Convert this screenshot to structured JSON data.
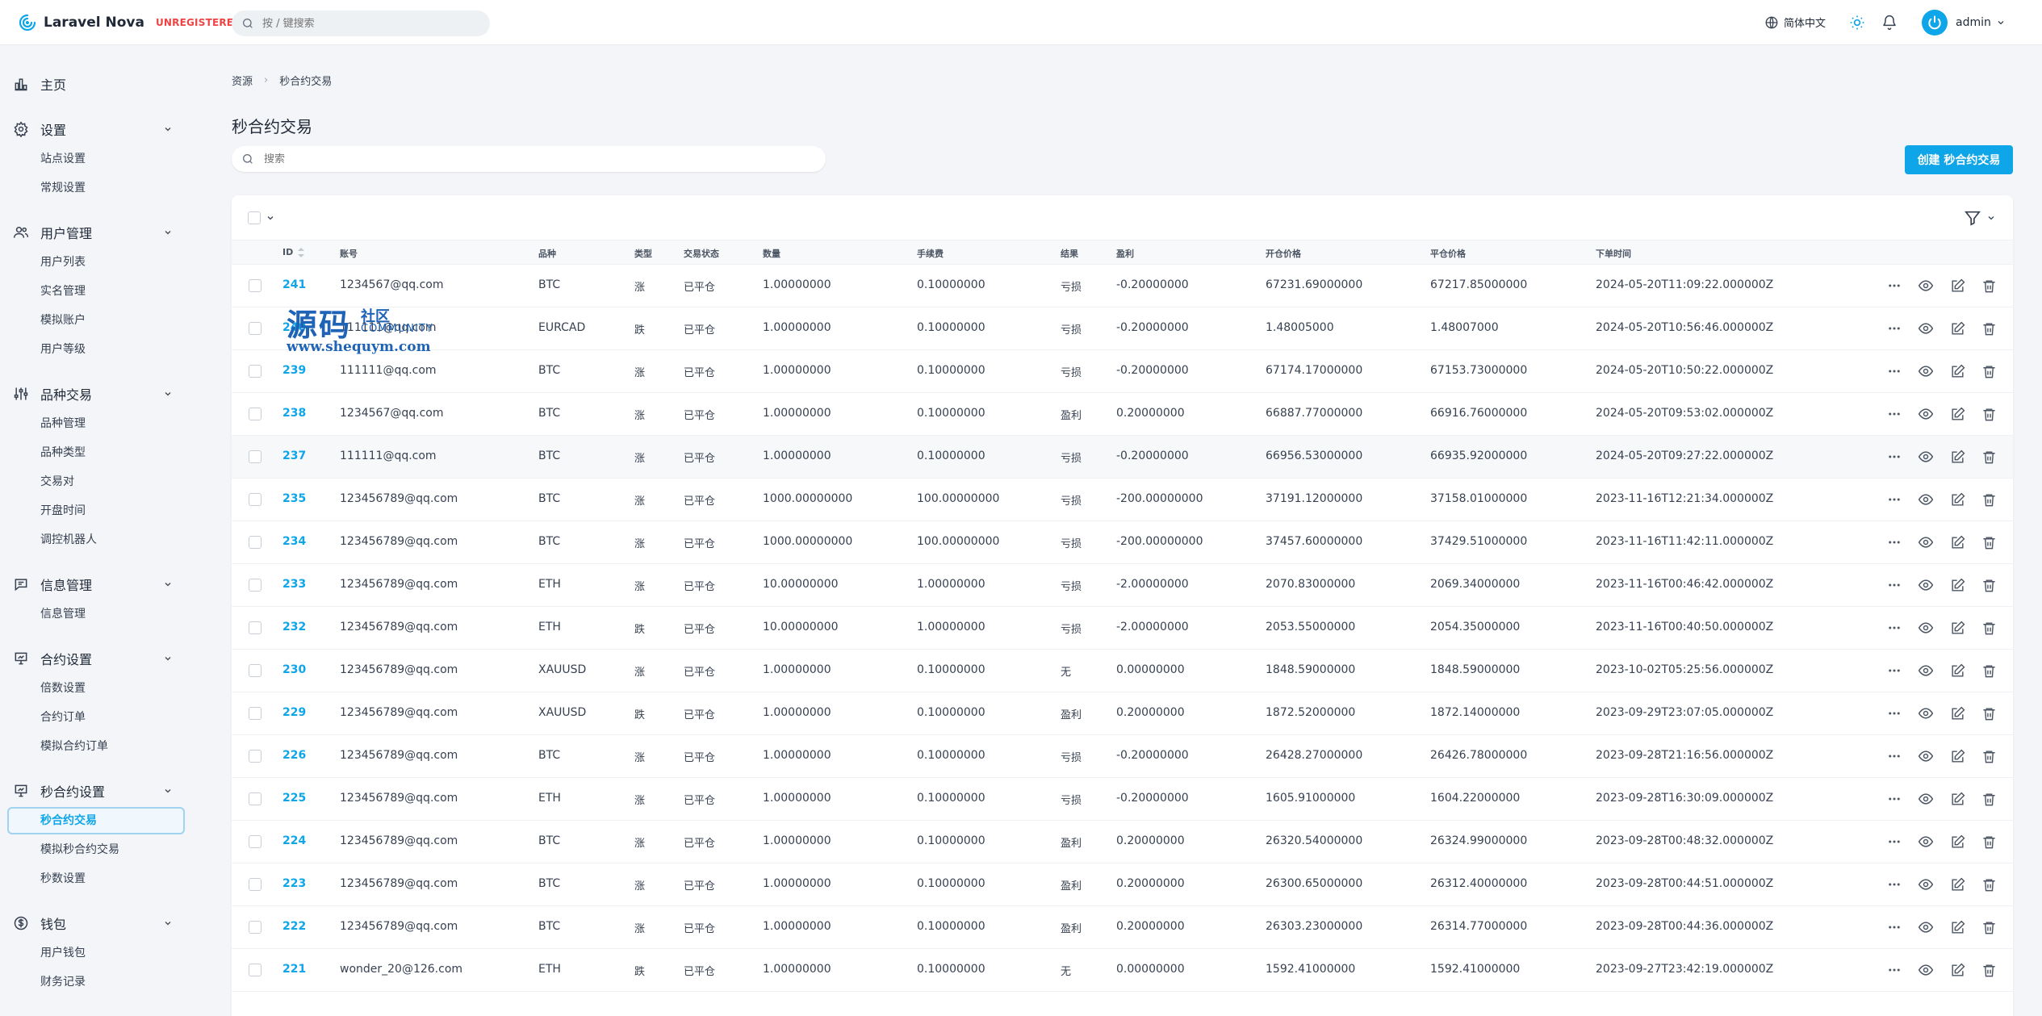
{
  "app": {
    "name": "Laravel Nova",
    "license_badge": "UNREGISTERED",
    "brand_color": "#0ea5e9"
  },
  "topbar": {
    "search_placeholder": "按 / 键搜索",
    "language": "简体中文",
    "user_name": "admin"
  },
  "sidebar": {
    "groups": [
      {
        "label": "主页",
        "icon": "dashboard-chart-icon",
        "items": []
      },
      {
        "label": "设置",
        "icon": "gear-icon",
        "items": [
          "站点设置",
          "常规设置"
        ]
      },
      {
        "label": "用户管理",
        "icon": "users-icon",
        "items": [
          "用户列表",
          "实名管理",
          "模拟账户",
          "用户等级"
        ]
      },
      {
        "label": "品种交易",
        "icon": "sliders-icon",
        "items": [
          "品种管理",
          "品种类型",
          "交易对",
          "开盘时间",
          "调控机器人"
        ]
      },
      {
        "label": "信息管理",
        "icon": "chat-icon",
        "items": [
          "信息管理"
        ]
      },
      {
        "label": "合约设置",
        "icon": "presentation-chart-icon",
        "items": [
          "倍数设置",
          "合约订单",
          "模拟合约订单"
        ]
      },
      {
        "label": "秒合约设置",
        "icon": "presentation-chart-icon",
        "items": [
          "秒合约交易",
          "模拟秒合约交易",
          "秒数设置"
        ]
      },
      {
        "label": "钱包",
        "icon": "currency-dollar-icon",
        "items": [
          "用户钱包",
          "财务记录"
        ]
      }
    ],
    "active_item": "秒合约交易"
  },
  "breadcrumb": {
    "root": "资源",
    "current": "秒合约交易"
  },
  "page": {
    "title": "秒合约交易",
    "search_placeholder": "搜索",
    "create_button": "创建 秒合约交易"
  },
  "table": {
    "columns": [
      "ID",
      "账号",
      "品种",
      "类型",
      "交易状态",
      "数量",
      "手续费",
      "结果",
      "盈利",
      "开仓价格",
      "平仓价格",
      "下单时间"
    ],
    "rows": [
      [
        "241",
        "1234567@qq.com",
        "BTC",
        "涨",
        "已平仓",
        "1.00000000",
        "0.10000000",
        "亏损",
        "-0.20000000",
        "67231.69000000",
        "67217.85000000",
        "2024-05-20T11:09:22.000000Z"
      ],
      [
        "240",
        "111111@qq.com",
        "EURCAD",
        "跌",
        "已平仓",
        "1.00000000",
        "0.10000000",
        "亏损",
        "-0.20000000",
        "1.48005000",
        "1.48007000",
        "2024-05-20T10:56:46.000000Z"
      ],
      [
        "239",
        "111111@qq.com",
        "BTC",
        "涨",
        "已平仓",
        "1.00000000",
        "0.10000000",
        "亏损",
        "-0.20000000",
        "67174.17000000",
        "67153.73000000",
        "2024-05-20T10:50:22.000000Z"
      ],
      [
        "238",
        "1234567@qq.com",
        "BTC",
        "涨",
        "已平仓",
        "1.00000000",
        "0.10000000",
        "盈利",
        "0.20000000",
        "66887.77000000",
        "66916.76000000",
        "2024-05-20T09:53:02.000000Z"
      ],
      [
        "237",
        "111111@qq.com",
        "BTC",
        "涨",
        "已平仓",
        "1.00000000",
        "0.10000000",
        "亏损",
        "-0.20000000",
        "66956.53000000",
        "66935.92000000",
        "2024-05-20T09:27:22.000000Z"
      ],
      [
        "235",
        "123456789@qq.com",
        "BTC",
        "涨",
        "已平仓",
        "1000.00000000",
        "100.00000000",
        "亏损",
        "-200.00000000",
        "37191.12000000",
        "37158.01000000",
        "2023-11-16T12:21:34.000000Z"
      ],
      [
        "234",
        "123456789@qq.com",
        "BTC",
        "涨",
        "已平仓",
        "1000.00000000",
        "100.00000000",
        "亏损",
        "-200.00000000",
        "37457.60000000",
        "37429.51000000",
        "2023-11-16T11:42:11.000000Z"
      ],
      [
        "233",
        "123456789@qq.com",
        "ETH",
        "涨",
        "已平仓",
        "10.00000000",
        "1.00000000",
        "亏损",
        "-2.00000000",
        "2070.83000000",
        "2069.34000000",
        "2023-11-16T00:46:42.000000Z"
      ],
      [
        "232",
        "123456789@qq.com",
        "ETH",
        "跌",
        "已平仓",
        "10.00000000",
        "1.00000000",
        "亏损",
        "-2.00000000",
        "2053.55000000",
        "2054.35000000",
        "2023-11-16T00:40:50.000000Z"
      ],
      [
        "230",
        "123456789@qq.com",
        "XAUUSD",
        "涨",
        "已平仓",
        "1.00000000",
        "0.10000000",
        "无",
        "0.00000000",
        "1848.59000000",
        "1848.59000000",
        "2023-10-02T05:25:56.000000Z"
      ],
      [
        "229",
        "123456789@qq.com",
        "XAUUSD",
        "跌",
        "已平仓",
        "1.00000000",
        "0.10000000",
        "盈利",
        "0.20000000",
        "1872.52000000",
        "1872.14000000",
        "2023-09-29T23:07:05.000000Z"
      ],
      [
        "226",
        "123456789@qq.com",
        "BTC",
        "涨",
        "已平仓",
        "1.00000000",
        "0.10000000",
        "亏损",
        "-0.20000000",
        "26428.27000000",
        "26426.78000000",
        "2023-09-28T21:16:56.000000Z"
      ],
      [
        "225",
        "123456789@qq.com",
        "ETH",
        "涨",
        "已平仓",
        "1.00000000",
        "0.10000000",
        "亏损",
        "-0.20000000",
        "1605.91000000",
        "1604.22000000",
        "2023-09-28T16:30:09.000000Z"
      ],
      [
        "224",
        "123456789@qq.com",
        "BTC",
        "涨",
        "已平仓",
        "1.00000000",
        "0.10000000",
        "盈利",
        "0.20000000",
        "26320.54000000",
        "26324.99000000",
        "2023-09-28T00:48:32.000000Z"
      ],
      [
        "223",
        "123456789@qq.com",
        "BTC",
        "涨",
        "已平仓",
        "1.00000000",
        "0.10000000",
        "盈利",
        "0.20000000",
        "26300.65000000",
        "26312.40000000",
        "2023-09-28T00:44:51.000000Z"
      ],
      [
        "222",
        "123456789@qq.com",
        "BTC",
        "涨",
        "已平仓",
        "1.00000000",
        "0.10000000",
        "盈利",
        "0.20000000",
        "26303.23000000",
        "26314.77000000",
        "2023-09-28T00:44:36.000000Z"
      ],
      [
        "221",
        "wonder_20@126.com",
        "ETH",
        "跌",
        "已平仓",
        "1.00000000",
        "0.10000000",
        "无",
        "0.00000000",
        "1592.41000000",
        "1592.41000000",
        "2023-09-27T23:42:19.000000Z"
      ]
    ],
    "row_actions": [
      "more-icon",
      "eye-icon",
      "edit-icon",
      "trash-icon"
    ]
  },
  "watermark": {
    "title": "源码",
    "subtitle": "社区",
    "community": "COMMUNITY",
    "url": "www.shequym.com"
  }
}
